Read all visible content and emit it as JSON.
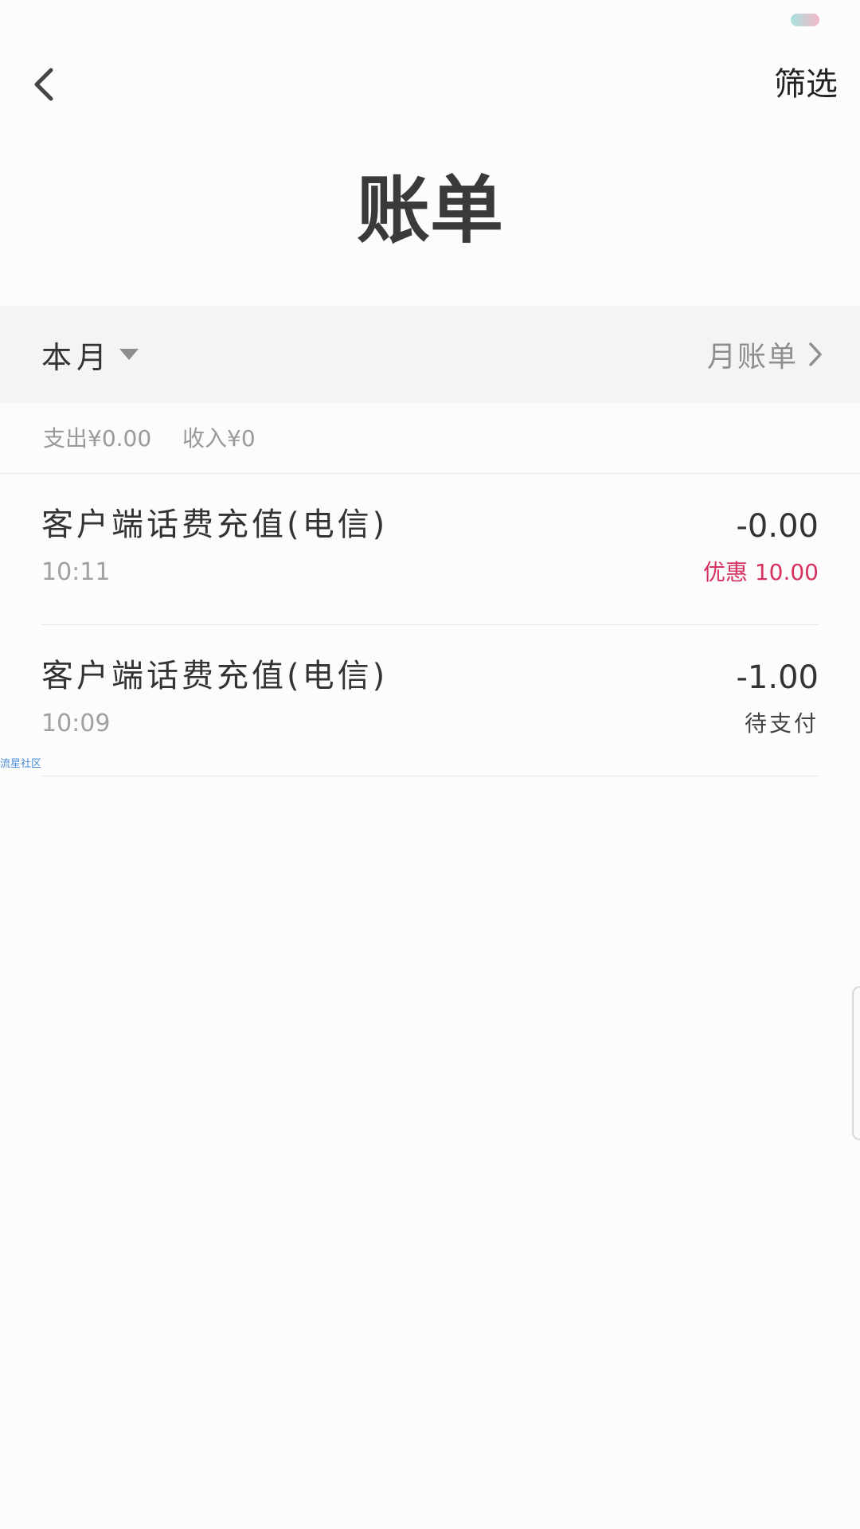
{
  "status_bar": {
    "pill_colors": [
      "#a6e3e0",
      "#f4b6c6"
    ]
  },
  "header": {
    "back_icon": "chevron-left-icon",
    "filter_label": "筛选"
  },
  "page": {
    "title": "账单"
  },
  "month_bar": {
    "selected_month": "本月",
    "dropdown_icon": "caret-down-icon",
    "monthly_bill_label": "月账单",
    "monthly_bill_icon": "chevron-right-icon"
  },
  "summary": {
    "expense": "支出¥0.00",
    "income": "收入¥0"
  },
  "transactions": [
    {
      "title": "客户端话费充值(电信)",
      "time": "10:11",
      "amount": "-0.00",
      "sub": "优惠 10.00",
      "sub_type": "discount"
    },
    {
      "title": "客户端话费充值(电信)",
      "time": "10:09",
      "amount": "-1.00",
      "sub": "待支付",
      "sub_type": "pending"
    }
  ],
  "watermark": "流星社区",
  "colors": {
    "discount": "#d6315f",
    "month_bar_bg": "#f4f4f4",
    "watermark": "#4a8bd6"
  }
}
